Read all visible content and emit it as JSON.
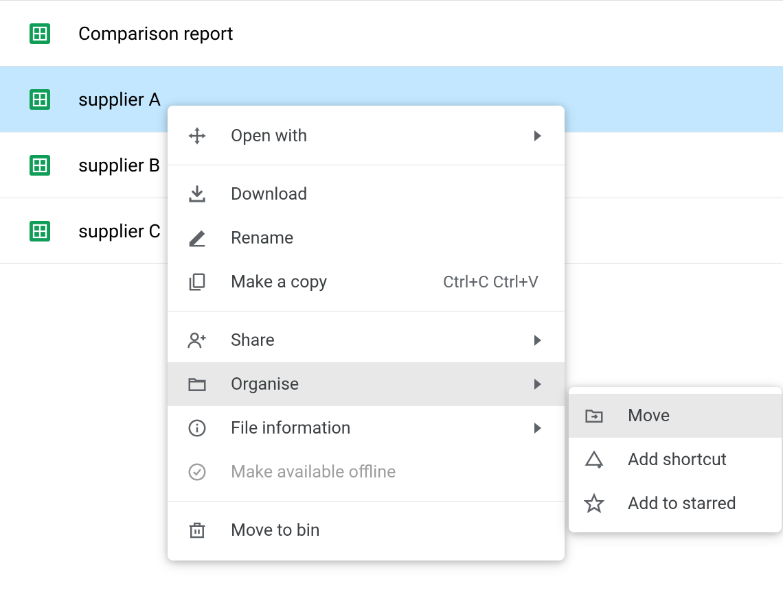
{
  "files": [
    {
      "name": "Comparison report"
    },
    {
      "name": "supplier A"
    },
    {
      "name": "supplier B"
    },
    {
      "name": "supplier C"
    }
  ],
  "contextMenu": {
    "openWith": "Open with",
    "download": "Download",
    "rename": "Rename",
    "makeCopy": "Make a copy",
    "makeCopyShortcut": "Ctrl+C Ctrl+V",
    "share": "Share",
    "organise": "Organise",
    "fileInformation": "File information",
    "makeAvailableOffline": "Make available offline",
    "moveToBin": "Move to bin"
  },
  "submenu": {
    "move": "Move",
    "addShortcut": "Add shortcut",
    "addToStarred": "Add to starred"
  }
}
